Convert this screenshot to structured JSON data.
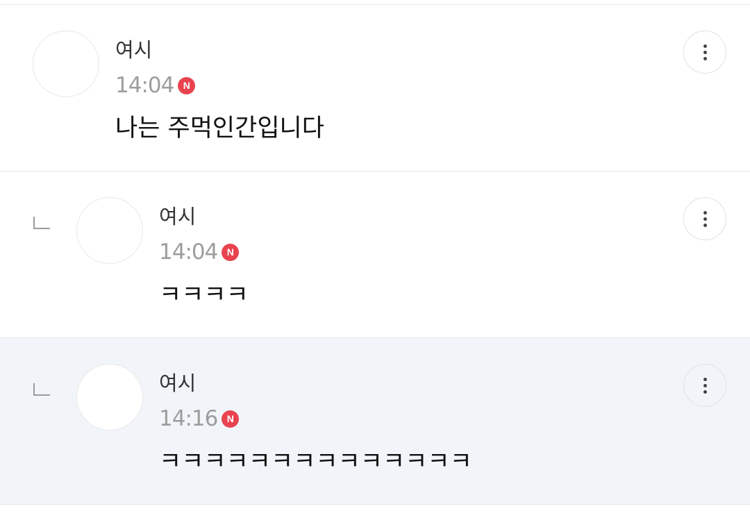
{
  "comments": [
    {
      "author": "여시",
      "time": "14:04",
      "badge": "N",
      "text": "나는 주먹인간입니다",
      "is_reply": false
    },
    {
      "author": "여시",
      "time": "14:04",
      "badge": "N",
      "text": "ㅋㅋㅋㅋ",
      "is_reply": true
    },
    {
      "author": "여시",
      "time": "14:16",
      "badge": "N",
      "text": "ㅋㅋㅋㅋㅋㅋㅋㅋㅋㅋㅋㅋㅋㅋ",
      "is_reply": true
    }
  ],
  "icons": {
    "more": "more-vertical-icon",
    "reply": "reply-indent-icon",
    "new_badge": "new-badge-icon"
  },
  "colors": {
    "badge": "#e8434f",
    "highlight_bg": "#f1f5fa",
    "time_text": "#9d9d9d"
  }
}
